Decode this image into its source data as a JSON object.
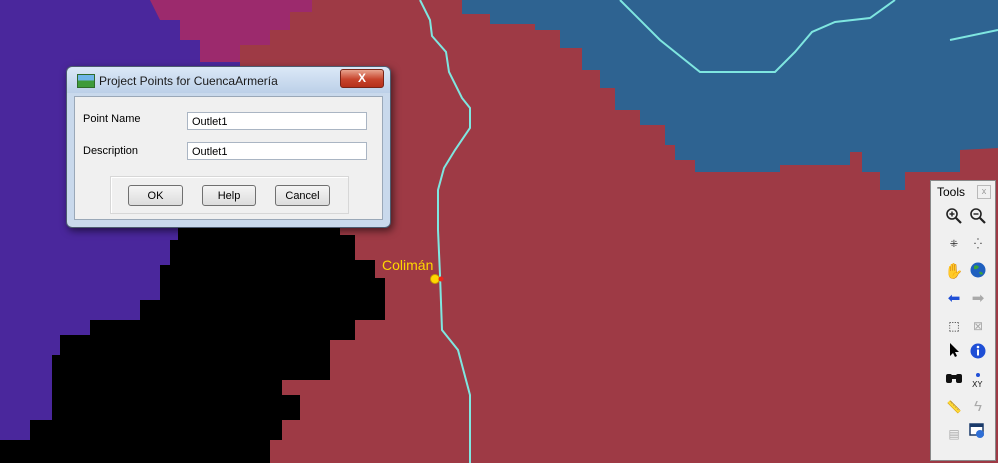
{
  "map": {
    "point_label": "Colimán",
    "colors": {
      "basin_red": "#9e3a45",
      "basin_blue": "#2e6391",
      "basin_purple": "#4a279c",
      "basin_magenta": "#9c2a6d",
      "nodata_black": "#000000",
      "stream_cyan": "#7fe6e0",
      "label_yellow": "#ffd800"
    }
  },
  "dialog": {
    "title": "Project Points for CuencaArmería",
    "close_label": "X",
    "fields": {
      "point_name_label": "Point Name",
      "point_name_value": "Outlet1",
      "description_label": "Description",
      "description_value": "Outlet1"
    },
    "buttons": {
      "ok": "OK",
      "help": "Help",
      "cancel": "Cancel"
    }
  },
  "tools": {
    "title": "Tools",
    "close_label": "x",
    "icons": [
      "zoom-in-icon",
      "zoom-out-icon",
      "zoom-to-extent-icon",
      "full-extent-icon",
      "pan-hand-icon",
      "globe-icon",
      "back-arrow-icon",
      "forward-arrow-icon",
      "select-features-icon",
      "clear-selection-icon",
      "pointer-icon",
      "identify-icon",
      "find-binoculars-icon",
      "go-to-xy-icon",
      "measure-icon",
      "hyperlink-icon",
      "html-popup-icon",
      "viewer-window-icon"
    ]
  }
}
